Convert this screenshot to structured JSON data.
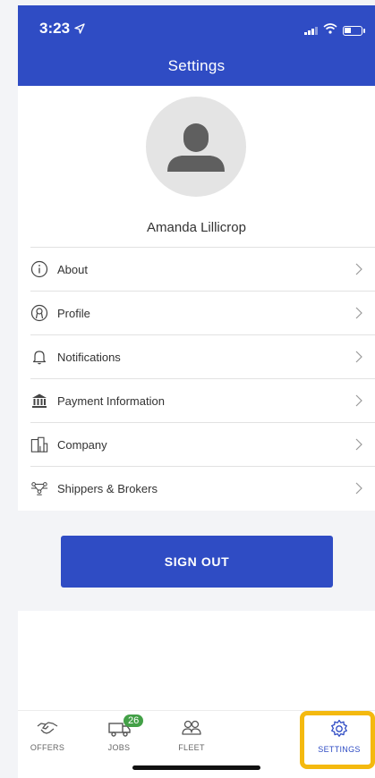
{
  "status_bar": {
    "time": "3:23"
  },
  "header": {
    "title": "Settings"
  },
  "profile": {
    "name": "Amanda Lillicrop"
  },
  "menu": {
    "items": [
      {
        "label": "About",
        "icon": "info-icon"
      },
      {
        "label": "Profile",
        "icon": "profile-icon"
      },
      {
        "label": "Notifications",
        "icon": "bell-icon"
      },
      {
        "label": "Payment Information",
        "icon": "bank-icon"
      },
      {
        "label": "Company",
        "icon": "building-icon"
      },
      {
        "label": "Shippers & Brokers",
        "icon": "network-icon"
      }
    ]
  },
  "sign_out": {
    "label": "SIGN OUT"
  },
  "tabbar": {
    "offers": "OFFERS",
    "jobs": "JOBS",
    "jobs_badge": "26",
    "fleet": "FLEET",
    "settings": "SETTINGS",
    "active": "settings"
  },
  "colors": {
    "brand": "#2f4cc4",
    "badge": "#43a047",
    "highlight": "#f4b90f"
  }
}
